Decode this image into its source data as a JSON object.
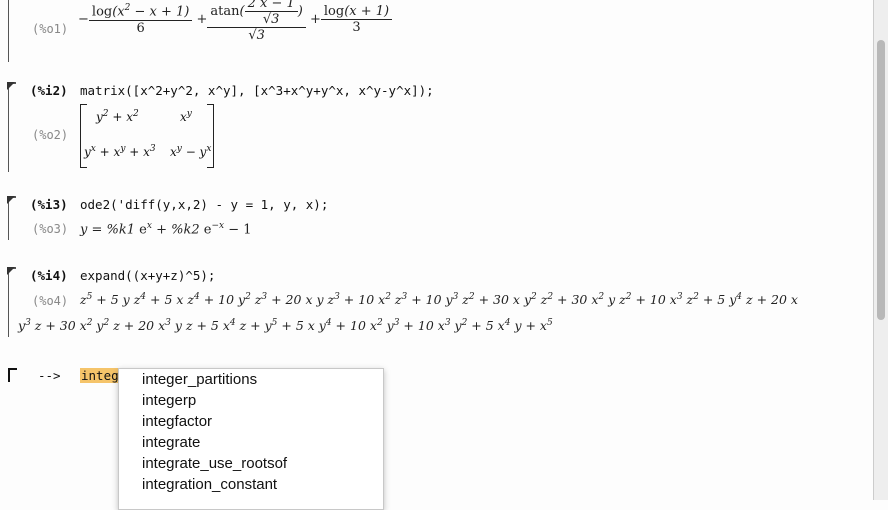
{
  "cells": {
    "o1": {
      "label": "(%o1)"
    },
    "i2": {
      "label": "(%i2)",
      "input": "matrix([x^2+y^2, x^y], [x^3+x^y+y^x, x^y-y^x]);"
    },
    "o2": {
      "label": "(%o2)"
    },
    "i3": {
      "label": "(%i3)",
      "input": "ode2('diff(y,x,2) - y = 1, y, x);"
    },
    "o3": {
      "label": "(%o3)"
    },
    "i4": {
      "label": "(%i4)",
      "input": "expand((x+y+z)^5);"
    },
    "o4": {
      "label": "(%o4)"
    }
  },
  "prompt": {
    "arrow": "-->",
    "typed": "integ"
  },
  "autocomplete": {
    "items": [
      "integer_partitions",
      "integerp",
      "integfactor",
      "integrate",
      "integrate_use_rootsof",
      "integration_constant"
    ]
  },
  "colors": {
    "highlight": "#f5c46a",
    "output_label": "#888888"
  }
}
